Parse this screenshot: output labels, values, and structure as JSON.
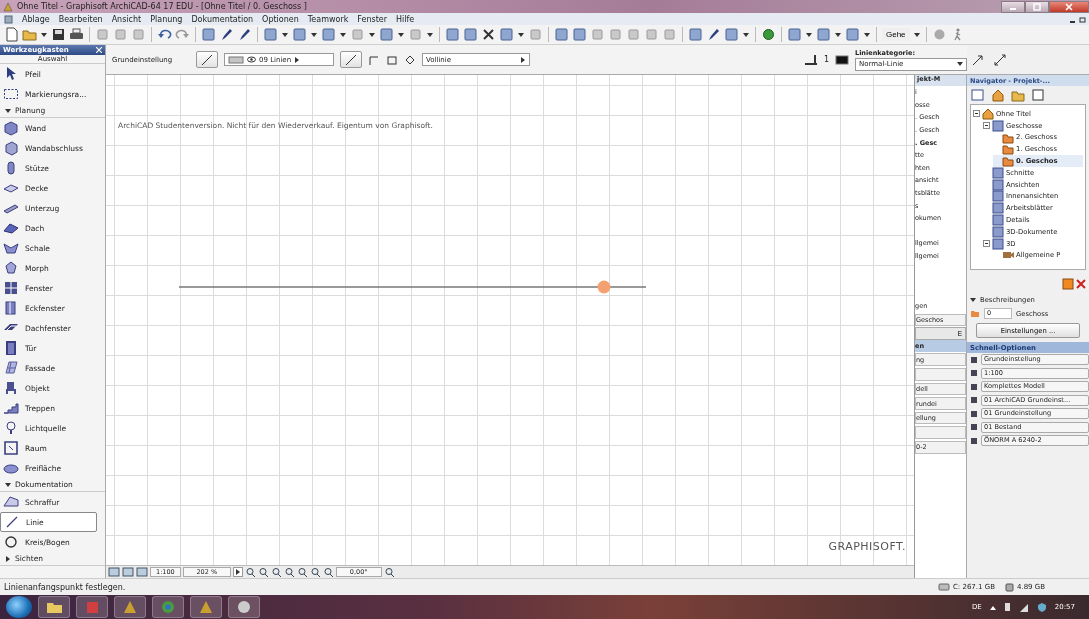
{
  "window": {
    "title": "Ohne Titel - Graphisoft ArchiCAD-64 17 EDU - [Ohne Titel / 0. Geschoss ]"
  },
  "menu": [
    "Ablage",
    "Bearbeiten",
    "Ansicht",
    "Planung",
    "Dokumentation",
    "Optionen",
    "Teamwork",
    "Fenster",
    "Hilfe"
  ],
  "toolbar": {
    "goto": "Gehe"
  },
  "toolbox": {
    "title": "Werkzeugkasten",
    "section": "Auswahl",
    "items": [
      {
        "kind": "tool",
        "label": "Pfeil",
        "selected": false
      },
      {
        "kind": "tool",
        "label": "Markierungsra...",
        "selected": false
      },
      {
        "kind": "group",
        "label": "Planung",
        "expanded": true
      },
      {
        "kind": "tool",
        "label": "Wand",
        "selected": false
      },
      {
        "kind": "tool",
        "label": "Wandabschluss",
        "selected": false
      },
      {
        "kind": "tool",
        "label": "Stütze",
        "selected": false
      },
      {
        "kind": "tool",
        "label": "Decke",
        "selected": false
      },
      {
        "kind": "tool",
        "label": "Unterzug",
        "selected": false
      },
      {
        "kind": "tool",
        "label": "Dach",
        "selected": false
      },
      {
        "kind": "tool",
        "label": "Schale",
        "selected": false
      },
      {
        "kind": "tool",
        "label": "Morph",
        "selected": false
      },
      {
        "kind": "tool",
        "label": "Fenster",
        "selected": false
      },
      {
        "kind": "tool",
        "label": "Eckfenster",
        "selected": false
      },
      {
        "kind": "tool",
        "label": "Dachfenster",
        "selected": false
      },
      {
        "kind": "tool",
        "label": "Tür",
        "selected": false
      },
      {
        "kind": "tool",
        "label": "Fassade",
        "selected": false
      },
      {
        "kind": "tool",
        "label": "Objekt",
        "selected": false
      },
      {
        "kind": "tool",
        "label": "Treppen",
        "selected": false
      },
      {
        "kind": "tool",
        "label": "Lichtquelle",
        "selected": false
      },
      {
        "kind": "tool",
        "label": "Raum",
        "selected": false
      },
      {
        "kind": "tool",
        "label": "Freifläche",
        "selected": false
      },
      {
        "kind": "group",
        "label": "Dokumentation",
        "expanded": true
      },
      {
        "kind": "tool",
        "label": "Schraffur",
        "selected": false
      },
      {
        "kind": "tool",
        "label": "Linie",
        "selected": true
      },
      {
        "kind": "tool",
        "label": "Kreis/Bogen",
        "selected": false
      },
      {
        "kind": "group",
        "label": "Sichten",
        "expanded": false
      }
    ]
  },
  "info_box": {
    "title": "Grundeinstellung",
    "layer": "09 Linien",
    "line_type": "Vollinie",
    "pen": "1",
    "category_label": "Linienkategorie:",
    "category": "Normal-Linie"
  },
  "canvas": {
    "notice": "ArchiCAD Studentenversion. Nicht für den Wiederverkauf. Eigentum von Graphisoft.",
    "brand": "GRAPHISOFT.",
    "scale": "1:100",
    "zoom": "202 %",
    "angle": "0,00°"
  },
  "project_map": {
    "title": "jekt-M",
    "rows": [
      {
        "kind": "item",
        "text": "i"
      },
      {
        "kind": "item",
        "text": "osse"
      },
      {
        "kind": "item",
        "text": ". Gesch"
      },
      {
        "kind": "item",
        "text": ". Gesch"
      },
      {
        "kind": "bold",
        "text": ". Gesc"
      },
      {
        "kind": "item",
        "text": "tte"
      },
      {
        "kind": "item",
        "text": "hten"
      },
      {
        "kind": "item",
        "text": "ansicht"
      },
      {
        "kind": "item",
        "text": "tsblätte"
      },
      {
        "kind": "item",
        "text": "s"
      },
      {
        "kind": "item",
        "text": "okumen"
      },
      {
        "kind": "gap"
      },
      {
        "kind": "item",
        "text": "llgemei"
      },
      {
        "kind": "item",
        "text": "llgemei"
      },
      {
        "kind": "gap"
      },
      {
        "kind": "gap"
      },
      {
        "kind": "gap"
      },
      {
        "kind": "item",
        "text": "gen"
      },
      {
        "kind": "field",
        "text": "Geschos"
      },
      {
        "kind": "button",
        "text": "E"
      },
      {
        "kind": "header",
        "text": "en"
      },
      {
        "kind": "field",
        "text": "ng"
      },
      {
        "kind": "field",
        "text": ""
      },
      {
        "kind": "field",
        "text": "dell"
      },
      {
        "kind": "field",
        "text": "rundei"
      },
      {
        "kind": "field",
        "text": "ellung"
      },
      {
        "kind": "field",
        "text": ""
      },
      {
        "kind": "field",
        "text": "0-2"
      }
    ]
  },
  "navigator": {
    "title": "Navigator - Projekt-...",
    "tree": [
      {
        "label": "Ohne Titel",
        "kind": "project",
        "selected": false,
        "expanded": true,
        "children": [
          {
            "label": "Geschosse",
            "kind": "view",
            "selected": false,
            "expanded": true,
            "children": [
              {
                "label": "2. Geschoss",
                "kind": "folder",
                "selected": false
              },
              {
                "label": "1. Geschoss",
                "kind": "folder",
                "selected": false
              },
              {
                "label": "0. Geschos",
                "kind": "folder",
                "selected": true
              }
            ]
          },
          {
            "label": "Schnitte",
            "kind": "view",
            "selected": false
          },
          {
            "label": "Ansichten",
            "kind": "view",
            "selected": false
          },
          {
            "label": "Innenansichten",
            "kind": "view",
            "selected": false
          },
          {
            "label": "Arbeitsblätter",
            "kind": "view",
            "selected": false
          },
          {
            "label": "Details",
            "kind": "view",
            "selected": false
          },
          {
            "label": "3D-Dokumente",
            "kind": "view",
            "selected": false
          },
          {
            "label": "3D",
            "kind": "view",
            "selected": false,
            "expanded": true,
            "children": [
              {
                "label": "Allgemeine P",
                "kind": "camera",
                "selected": false
              }
            ]
          }
        ]
      }
    ],
    "description_header": "Beschreibungen",
    "description_expanded": true,
    "id": "0",
    "name": "Geschoss",
    "settings_button": "Einstellungen ..."
  },
  "quick_options": {
    "title": "Schnell-Optionen",
    "rows": [
      "Grundeinstellung",
      "1:100",
      "Komplettes Modell",
      "01 ArchiCAD Grundeinst...",
      "01 Grundeinstellung",
      "01 Bestand",
      "ÖNORM A 6240-2"
    ]
  },
  "status_bar": {
    "message": "Linienanfangspunkt festlegen.",
    "disk": "C: 267.1 GB",
    "memory": "4.89 GB"
  },
  "taskbar": {
    "language": "DE",
    "time": "20:57"
  }
}
